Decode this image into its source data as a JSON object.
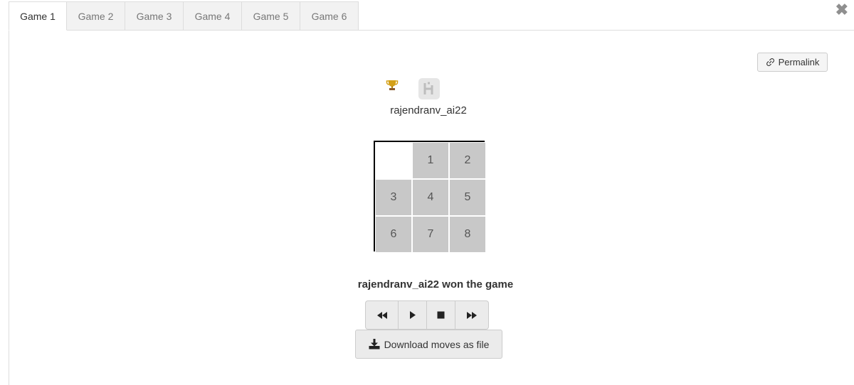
{
  "tabs": [
    {
      "label": "Game 1",
      "active": true
    },
    {
      "label": "Game 2",
      "active": false
    },
    {
      "label": "Game 3",
      "active": false
    },
    {
      "label": "Game 4",
      "active": false
    },
    {
      "label": "Game 5",
      "active": false
    },
    {
      "label": "Game 6",
      "active": false
    }
  ],
  "close_icon": "close-icon",
  "permalink": {
    "label": "Permalink",
    "icon": "link-icon"
  },
  "player": {
    "name": "rajendranv_ai22",
    "trophy_icon": "trophy-icon",
    "logo_icon": "player-logo-icon"
  },
  "board": {
    "tiles": [
      "",
      "1",
      "2",
      "3",
      "4",
      "5",
      "6",
      "7",
      "8"
    ],
    "tile_color": "#c8c8c8"
  },
  "status": "rajendranv_ai22 won the game",
  "controls": [
    {
      "name": "rewind-button",
      "icon": "rewind-icon"
    },
    {
      "name": "play-button",
      "icon": "play-icon"
    },
    {
      "name": "stop-button",
      "icon": "stop-icon"
    },
    {
      "name": "fast-forward-button",
      "icon": "fast-forward-icon"
    }
  ],
  "download": {
    "label": "Download moves as file",
    "icon": "download-icon"
  }
}
